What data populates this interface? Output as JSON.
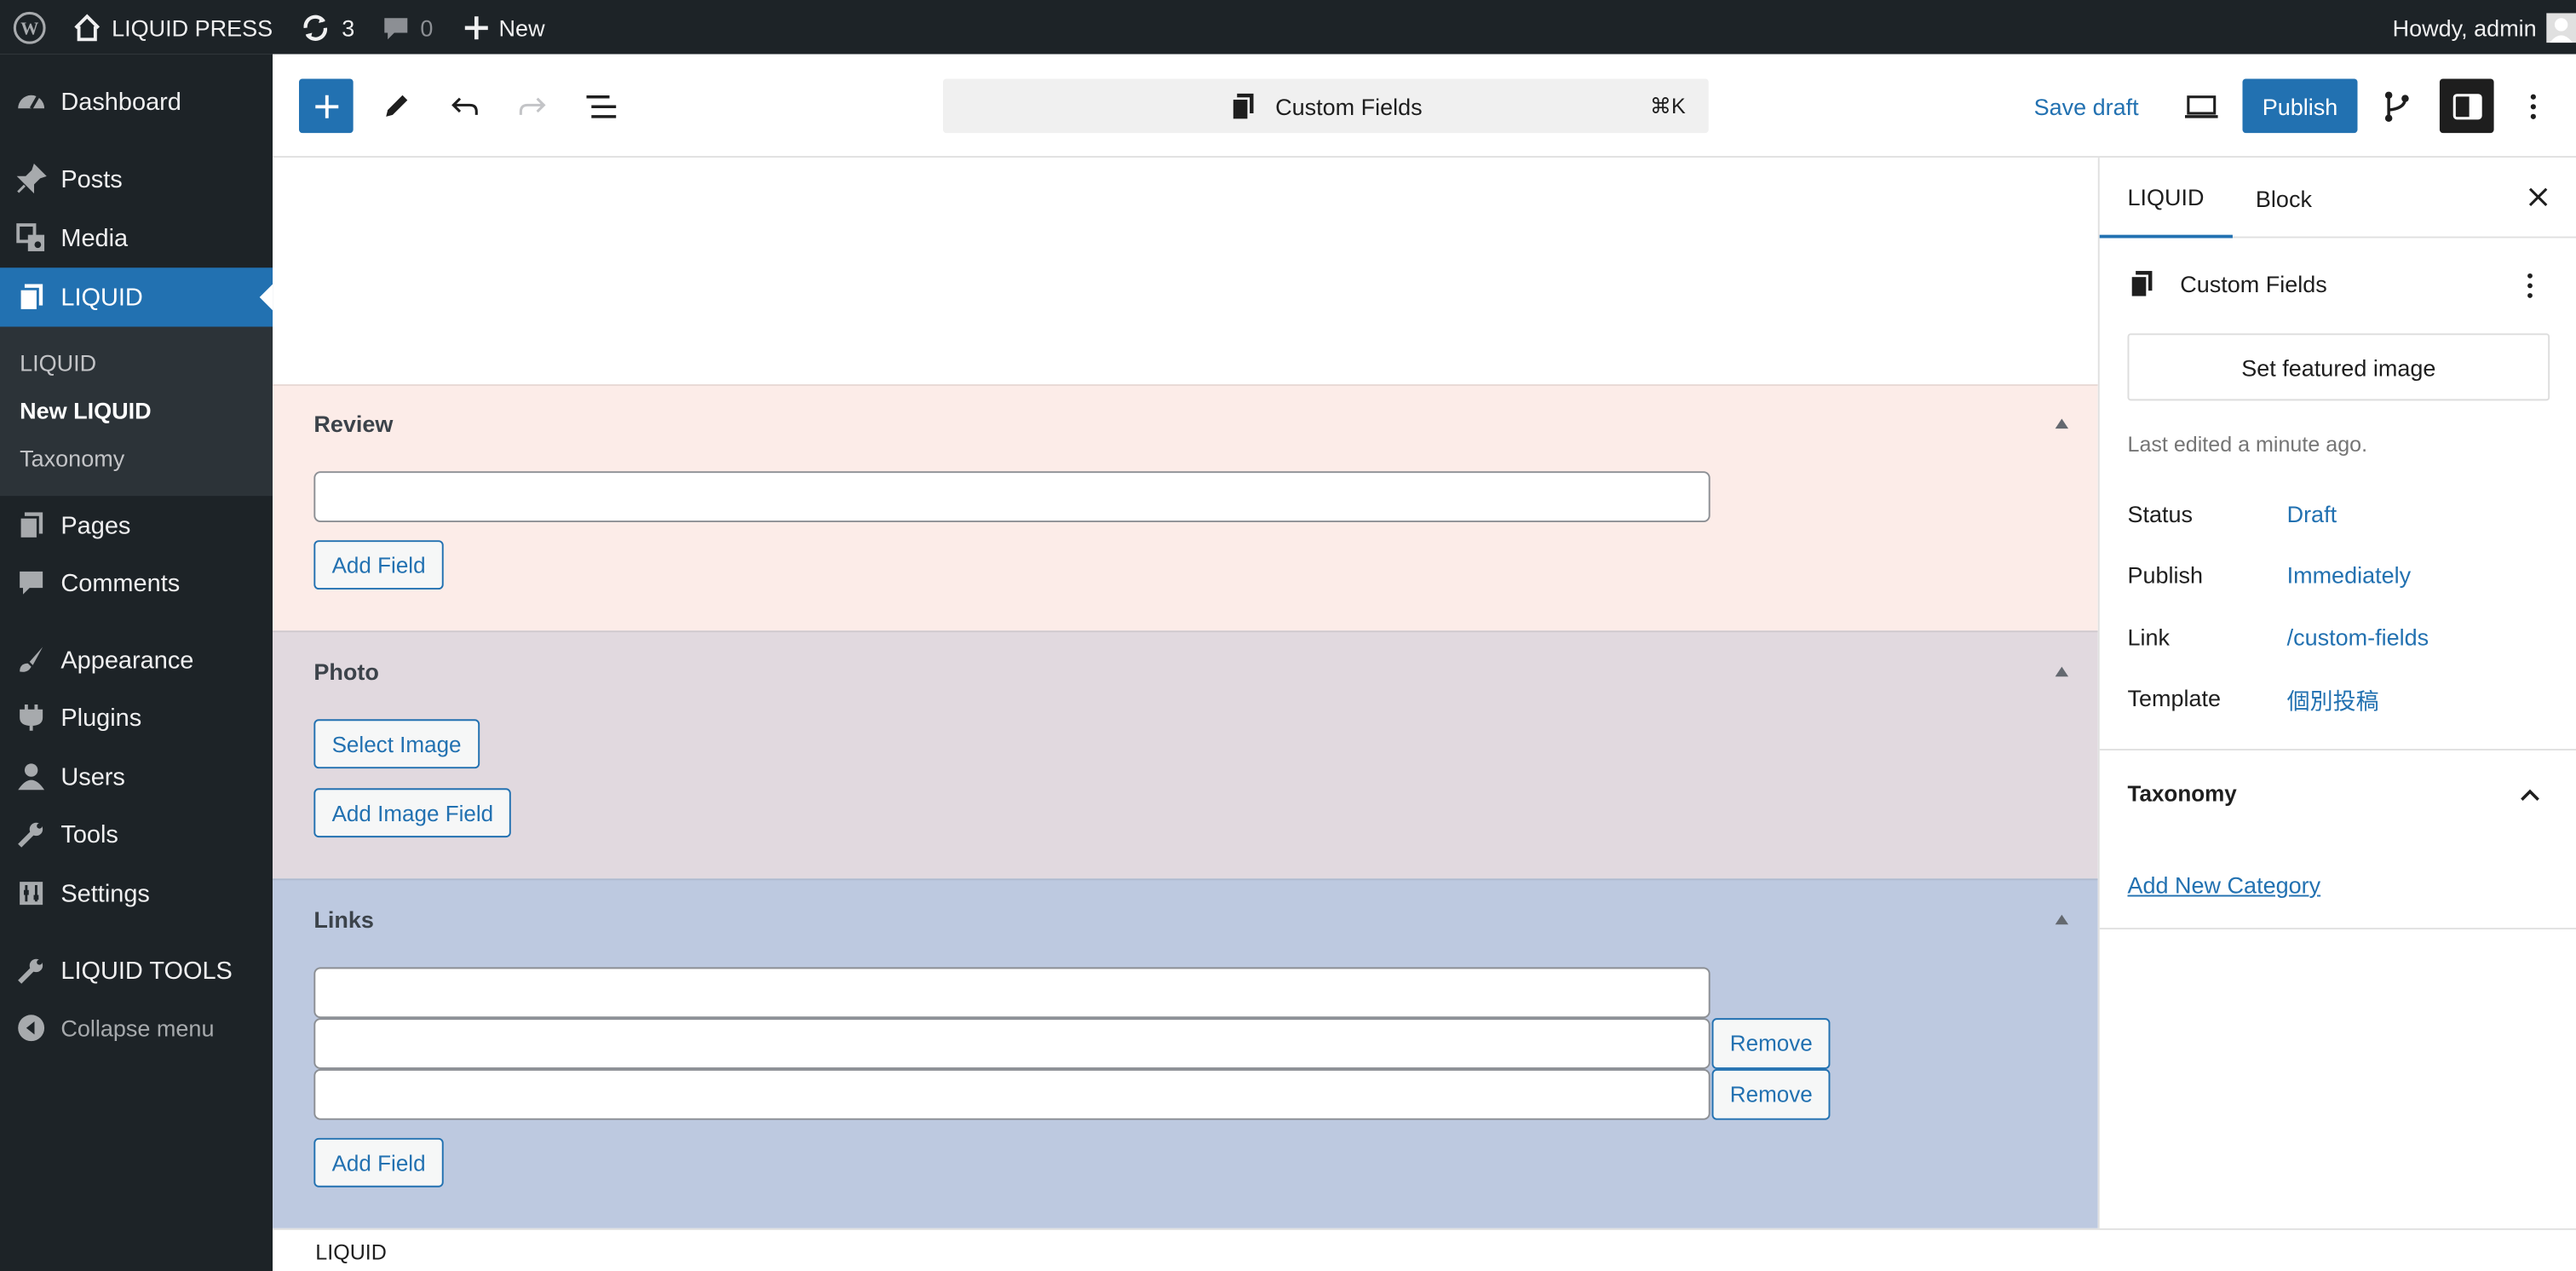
{
  "admin_bar": {
    "site_name": "LIQUID PRESS",
    "updates_count": "3",
    "comments_count": "0",
    "new_label": "New",
    "howdy": "Howdy, admin"
  },
  "sidebar": {
    "items": [
      {
        "label": "Dashboard",
        "icon": "dashboard-icon"
      },
      {
        "label": "Posts",
        "icon": "pin-icon"
      },
      {
        "label": "Media",
        "icon": "media-icon"
      },
      {
        "label": "LIQUID",
        "icon": "pages-icon"
      },
      {
        "label": "Pages",
        "icon": "pages-icon"
      },
      {
        "label": "Comments",
        "icon": "comment-icon"
      },
      {
        "label": "Appearance",
        "icon": "brush-icon"
      },
      {
        "label": "Plugins",
        "icon": "plugin-icon"
      },
      {
        "label": "Users",
        "icon": "user-icon"
      },
      {
        "label": "Tools",
        "icon": "wrench-icon"
      },
      {
        "label": "Settings",
        "icon": "settings-icon"
      },
      {
        "label": "LIQUID TOOLS",
        "icon": "wrench-icon"
      }
    ],
    "submenu": [
      "LIQUID",
      "New LIQUID",
      "Taxonomy"
    ],
    "collapse_label": "Collapse menu"
  },
  "editor": {
    "document_title": "Custom Fields",
    "shortcut": "⌘K",
    "save_draft": "Save draft",
    "publish": "Publish"
  },
  "metaboxes": {
    "review": {
      "title": "Review",
      "add_field": "Add Field",
      "bg": "#fcece8"
    },
    "photo": {
      "title": "Photo",
      "select_image": "Select Image",
      "add_image_field": "Add Image Field",
      "bg": "#e1d9df"
    },
    "links": {
      "title": "Links",
      "remove": "Remove",
      "add_field": "Add Field",
      "bg": "#bdc9e0"
    }
  },
  "footer": {
    "breadcrumb": "LIQUID"
  },
  "settings_panel": {
    "tabs": [
      "LIQUID",
      "Block"
    ],
    "post_title": "Custom Fields",
    "featured_image": "Set featured image",
    "last_edited": "Last edited a minute ago.",
    "rows": [
      {
        "label": "Status",
        "value": "Draft"
      },
      {
        "label": "Publish",
        "value": "Immediately"
      },
      {
        "label": "Link",
        "value": "/custom-fields"
      },
      {
        "label": "Template",
        "value": "個別投稿"
      }
    ],
    "taxonomy_title": "Taxonomy",
    "add_category": "Add New Category"
  },
  "colors": {
    "accent": "#2271b1",
    "admin_dark": "#1d2327"
  }
}
